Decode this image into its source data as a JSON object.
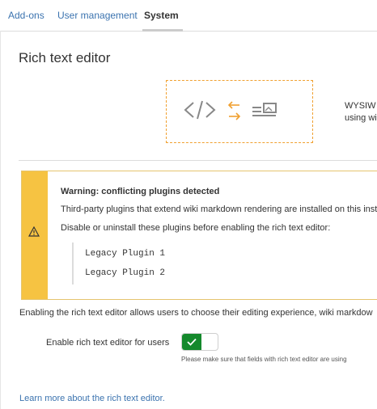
{
  "tabs": [
    {
      "label": "Add-ons",
      "active": false
    },
    {
      "label": "User management",
      "active": false
    },
    {
      "label": "System",
      "active": true
    }
  ],
  "page": {
    "title": "Rich text editor"
  },
  "hero": {
    "icons": [
      "code-brackets-icon",
      "swap-arrows-icon",
      "wysiwyg-image-icon"
    ],
    "text_line1": "WYSIW",
    "text_line2": "using wi"
  },
  "warning": {
    "title": "Warning: conflicting plugins detected",
    "line1": "Third-party plugins that extend wiki markdown rendering are installed on this inst",
    "line2": "Disable or uninstall these plugins before enabling the rich text editor:",
    "plugins": [
      "Legacy Plugin 1",
      "Legacy Plugin 2"
    ],
    "icon": "warning-triangle-icon",
    "color": "#f6c342"
  },
  "enable": {
    "description": "Enabling the rich text editor allows users to choose their editing experience, wiki markdow",
    "toggle_label": "Enable rich text editor for users",
    "toggle_on": true,
    "help": "Please make sure that fields with rich text editor are using"
  },
  "learn_more": "Learn more about the rich text editor.",
  "colors": {
    "link": "#3b73af",
    "toggle_on": "#14892c",
    "hero_border": "#f0a030"
  }
}
